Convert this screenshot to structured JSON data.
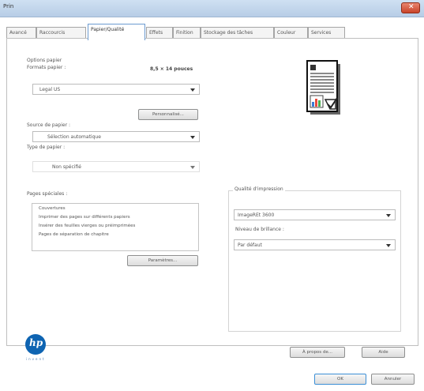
{
  "window": {
    "title": "Prin",
    "close_glyph": "✕"
  },
  "tabs": [
    {
      "label": "Avancé"
    },
    {
      "label": "Raccourcis"
    },
    {
      "label": "Papier/Qualité"
    },
    {
      "label": "Effets"
    },
    {
      "label": "Finition"
    },
    {
      "label": "Stockage des tâches"
    },
    {
      "label": "Couleur"
    },
    {
      "label": "Services"
    }
  ],
  "paper_options": {
    "title": "Options papier",
    "size_label": "Formats papier :",
    "size_value": "8,5 × 14 pouces",
    "size_selected": "Legal US",
    "custom_button": "Personnalisé...",
    "source_label": "Source de papier :",
    "source_selected": "Sélection automatique",
    "type_label": "Type de papier :",
    "type_selected": "Non spécifié"
  },
  "special_pages": {
    "label": "Pages spéciales :",
    "items": [
      "Couvertures",
      "Imprimer des pages sur différents papiers",
      "Insérer des feuilles vierges ou préimprimées",
      "Pages de séparation de chapitre"
    ],
    "params_button": "Paramètres..."
  },
  "print_quality": {
    "title": "Qualité d'impression",
    "quality_selected": "ImageREt 3600",
    "gloss_label": "Niveau de brillance :",
    "gloss_selected": "Par défaut"
  },
  "footer": {
    "brand": "hp",
    "tagline": "invent",
    "about_button": "À propos de...",
    "help_button": "Aide",
    "ok_button": "OK",
    "cancel_button": "Annuler"
  },
  "colors": {
    "hp_blue": "#0e64b2",
    "active_tab_border": "#6c9bd0"
  }
}
